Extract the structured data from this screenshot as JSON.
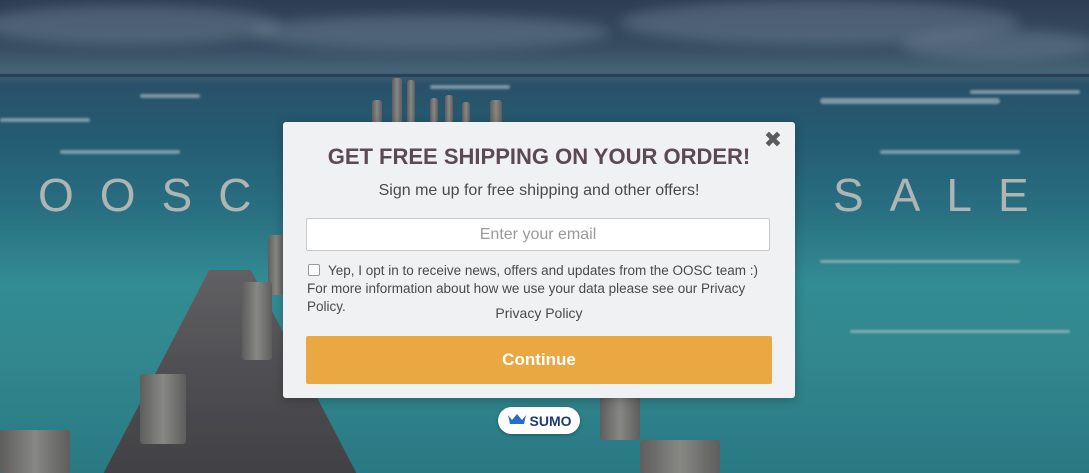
{
  "background": {
    "headline_left": "OOSC S",
    "headline_right": "SALE N"
  },
  "modal": {
    "title": "GET FREE SHIPPING ON YOUR ORDER!",
    "subtitle": "Sign me up for free shipping and other offers!",
    "email_placeholder": "Enter your email",
    "email_value": "",
    "optin_checked": false,
    "optin_text": "Yep, I opt in to receive news, offers and updates from the OOSC team :) For more information about how we use your data please see our Privacy Policy.",
    "privacy_link": "Privacy Policy",
    "continue_label": "Continue",
    "close_icon": "close-icon"
  },
  "badge": {
    "label": "SUMO",
    "icon": "crown-icon"
  },
  "colors": {
    "button": "#eaa843",
    "title": "#5b4a55",
    "sumo": "#1e3a6e"
  }
}
